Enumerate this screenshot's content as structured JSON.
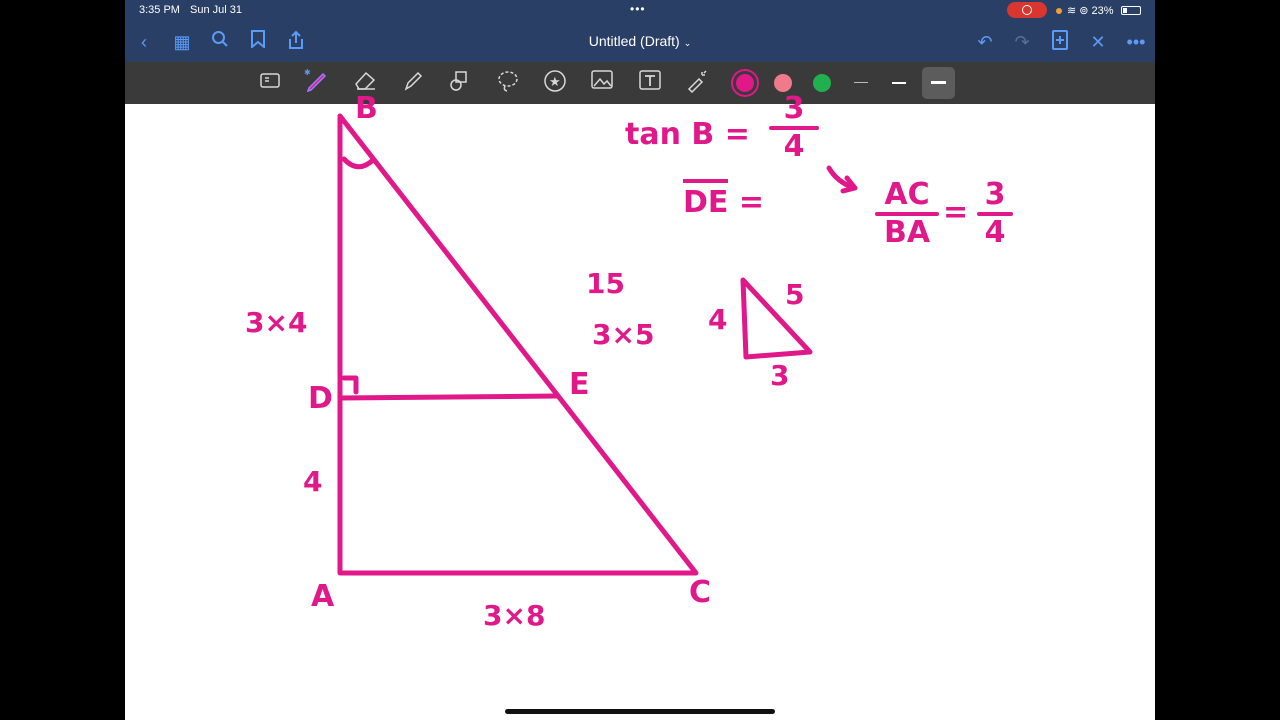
{
  "status": {
    "time": "3:35 PM",
    "date": "Sun Jul 31",
    "battery": "23%",
    "battery_level": 0.23
  },
  "nav": {
    "title": "Untitled (Draft)",
    "title_caret": "⌄",
    "buttons": [
      "back",
      "grid",
      "search",
      "bookmark",
      "share",
      "undo",
      "redo",
      "add-page",
      "close",
      "more"
    ]
  },
  "toolbar": {
    "tools": [
      "read-mode",
      "pen",
      "eraser",
      "highlighter",
      "shapes",
      "lasso",
      "elements",
      "image",
      "text",
      "laser"
    ],
    "colors": [
      "#e0188a",
      "#f07a8a",
      "#20b050"
    ],
    "selected_color": "#e0188a"
  },
  "canvas": {
    "labels": {
      "b": "B",
      "d": "D",
      "e": "E",
      "a": "A",
      "c": "C",
      "bd_len": "3×4",
      "ad_len": "4",
      "hyp_len_val": "15",
      "hyp_len": "3×5",
      "ac_len": "3×8"
    },
    "tan_eq": {
      "lhs": "tan B =",
      "num": "3",
      "den": "4"
    },
    "de_eq": {
      "var": "DE",
      "rhs": "="
    },
    "ratio_eq": {
      "arrow": "↘",
      "num": "AC",
      "den": "BA",
      "eq": "=",
      "rnum": "3",
      "rden": "4"
    },
    "small_tri": {
      "left": "4",
      "hyp": "5",
      "bottom": "3"
    }
  }
}
